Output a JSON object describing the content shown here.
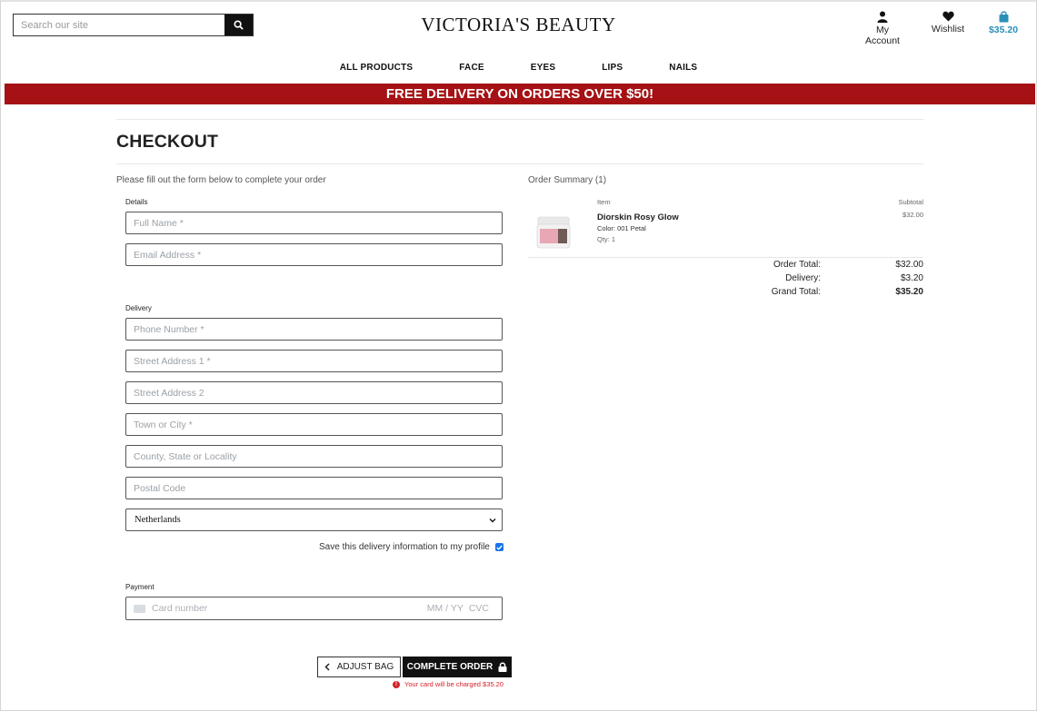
{
  "header": {
    "search_placeholder": "Search our site",
    "brand": "VICTORIA'S BEAUTY",
    "account_label": "My Account",
    "wishlist_label": "Wishlist",
    "bag_total": "$35.20"
  },
  "nav": [
    "ALL PRODUCTS",
    "FACE",
    "EYES",
    "LIPS",
    "NAILS"
  ],
  "banner": "FREE DELIVERY ON ORDERS OVER $50!",
  "page_title": "CHECKOUT",
  "form": {
    "intro": "Please fill out the form below to complete your order",
    "details_label": "Details",
    "full_name_placeholder": "Full Name *",
    "email_placeholder": "Email Address *",
    "delivery_label": "Delivery",
    "phone_placeholder": "Phone Number *",
    "street1_placeholder": "Street Address 1 *",
    "street2_placeholder": "Street Address 2",
    "city_placeholder": "Town or City *",
    "county_placeholder": "County, State or Locality",
    "postcode_placeholder": "Postal Code",
    "country_selected": "Netherlands",
    "save_info_label": "Save this delivery information to my profile",
    "payment_label": "Payment",
    "card_number_placeholder": "Card number",
    "card_expiry_placeholder": "MM / YY",
    "card_cvc_placeholder": "CVC",
    "adjust_bag_label": "ADJUST BAG",
    "complete_order_label": "COMPLETE ORDER",
    "charge_notice": "Your card will be charged $35.20"
  },
  "summary": {
    "heading": "Order Summary (1)",
    "item_col": "Item",
    "subtotal_col": "Subtotal",
    "item": {
      "name": "Diorskin Rosy Glow",
      "color": "Color: 001 Petal",
      "qty": "Qty: 1",
      "subtotal": "$32.00"
    },
    "order_total_label": "Order Total:",
    "order_total": "$32.00",
    "delivery_label": "Delivery:",
    "delivery": "$3.20",
    "grand_total_label": "Grand Total:",
    "grand_total": "$35.20"
  },
  "colors": {
    "banner": "#a51114",
    "bag_accent": "#2b8fb8",
    "error": "#d3232a"
  },
  "icons": [
    "search-icon",
    "user-icon",
    "heart-icon",
    "shopping-bag-icon",
    "chevron-down-icon",
    "chevron-left-icon",
    "lock-icon",
    "card-icon",
    "error-icon"
  ]
}
